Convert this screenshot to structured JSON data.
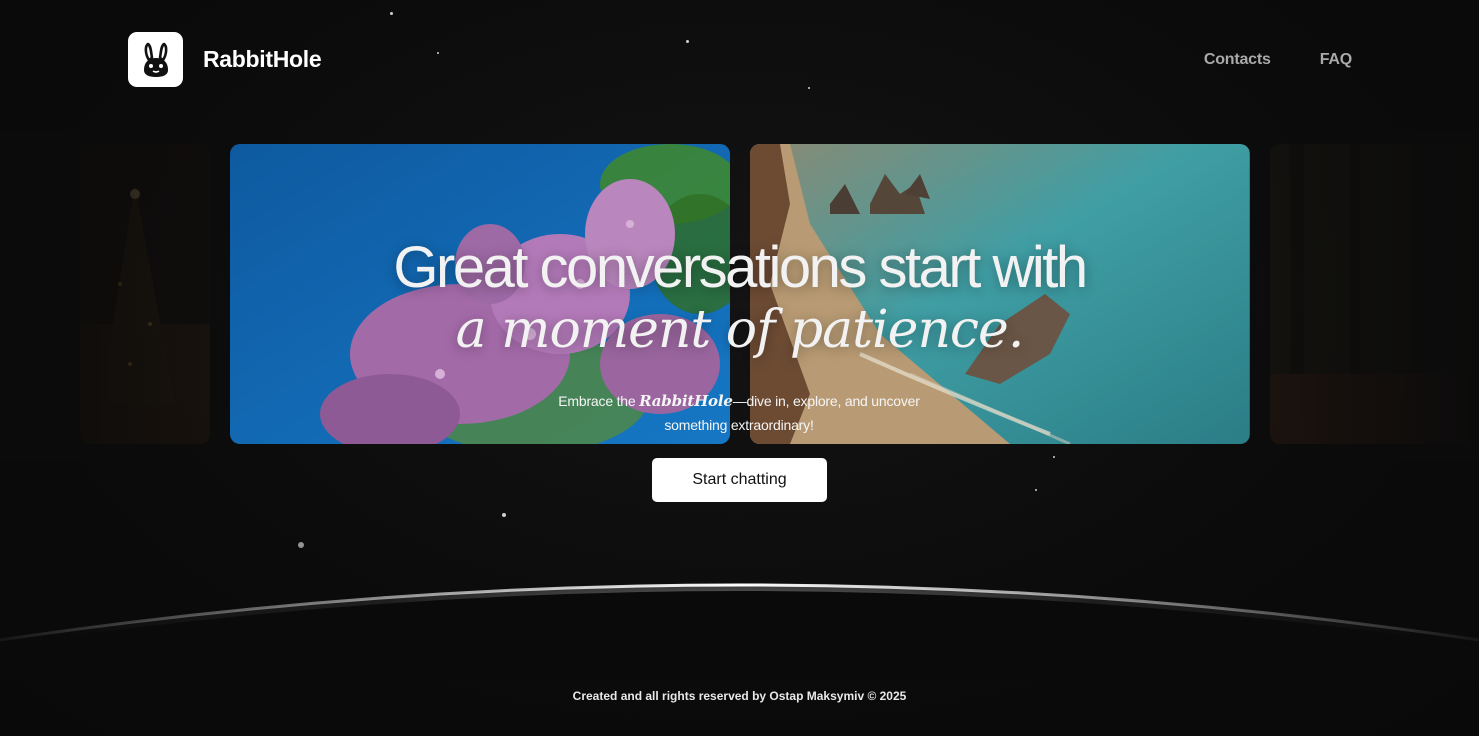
{
  "header": {
    "brand": "RabbitHole",
    "logo_icon": "rabbit-icon",
    "nav": [
      {
        "label": "Contacts"
      },
      {
        "label": "FAQ"
      }
    ]
  },
  "hero": {
    "title": "Great conversations start with",
    "subtitle": "a moment of patience.",
    "tagline_before": "Embrace the ",
    "tagline_brand": "RabbitHole",
    "tagline_after": "—dive in, explore, and uncover something extraordinary!",
    "cta_label": "Start chatting"
  },
  "carousel": {
    "cards": [
      {
        "name": "night-tree-card"
      },
      {
        "name": "lilac-flowers-card"
      },
      {
        "name": "beach-cliffs-card"
      },
      {
        "name": "forest-card"
      }
    ]
  },
  "footer": {
    "text": "Created and all rights reserved by Ostap Maksymiv © 2025"
  },
  "colors": {
    "background": "#0b0b0b",
    "text": "#ffffff",
    "nav_text": "#a9a9a9",
    "button_bg": "#ffffff"
  }
}
